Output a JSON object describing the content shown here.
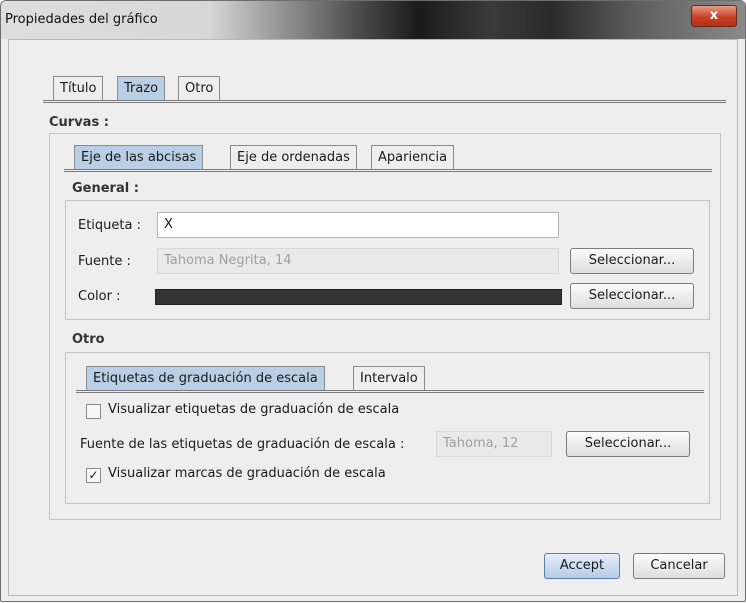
{
  "window": {
    "title": "Propiedades del gráfico",
    "close_label": "x"
  },
  "main_tabs": [
    {
      "label": "Título"
    },
    {
      "label": "Trazo"
    },
    {
      "label": "Otro"
    }
  ],
  "curvas": {
    "heading": "Curvas :",
    "tabs": [
      {
        "label": "Eje de las abcisas"
      },
      {
        "label": "Eje de ordenadas"
      },
      {
        "label": "Apariencia"
      }
    ],
    "general": {
      "heading": "General :",
      "etiqueta_label": "Etiqueta :",
      "etiqueta_value": "X",
      "fuente_label": "Fuente :",
      "fuente_value": "Tahoma Negrita, 14",
      "fuente_button": "Seleccionar...",
      "color_label": "Color :",
      "color_value": "#333333",
      "color_button": "Seleccionar..."
    },
    "otro": {
      "heading": "Otro",
      "tabs": [
        {
          "label": "Etiquetas de graduación de escala"
        },
        {
          "label": "Intervalo"
        }
      ],
      "show_labels": {
        "label": "Visualizar etiquetas de graduación de escala",
        "checked": false
      },
      "font_label": "Fuente de las etiquetas de graduación de escala :",
      "font_value": "Tahoma, 12",
      "font_button": "Seleccionar...",
      "show_marks": {
        "label": "Visualizar marcas de graduación de escala",
        "checked": true,
        "mark": "✓"
      }
    }
  },
  "footer": {
    "accept": "Accept",
    "cancel": "Cancelar"
  }
}
